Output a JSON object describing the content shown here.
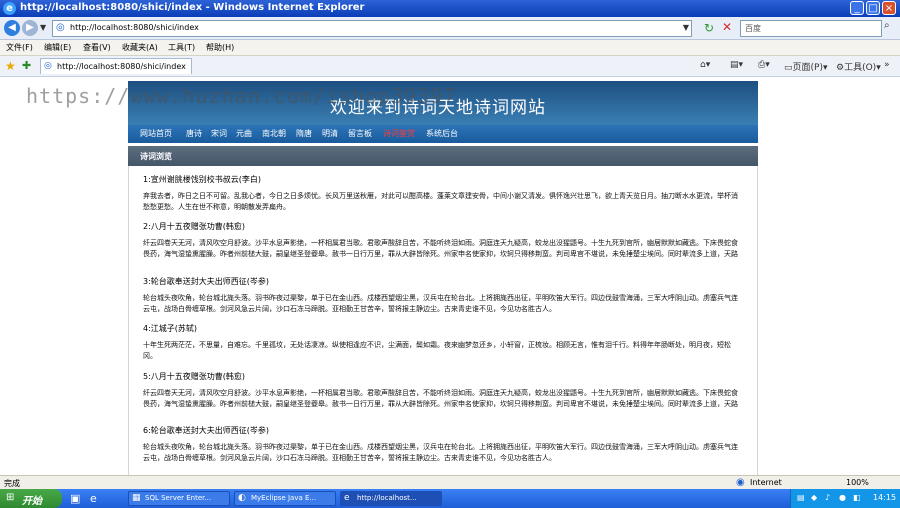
{
  "window": {
    "title": "http://localhost:8080/shici/index - Windows Internet Explorer",
    "min_glyph": "_",
    "max_glyph": "□",
    "close_glyph": "×"
  },
  "address": {
    "url": "http://localhost:8080/shici/index",
    "search_placeholder": "百度"
  },
  "menu": [
    "文件(F)",
    "编辑(E)",
    "查看(V)",
    "收藏夹(A)",
    "工具(T)",
    "帮助(H)"
  ],
  "tab": {
    "title": "http://localhost:8080/shici/index"
  },
  "toolbar": {
    "page": "页面(P)",
    "tools": "工具(O)",
    "more": "»"
  },
  "watermark": "https://www.huzhan.com/ishop39397",
  "site": {
    "banner_title": "欢迎来到诗词天地诗词网站",
    "nav": [
      "网站首页",
      "唐诗",
      "宋词",
      "元曲",
      "南北朝",
      "隋唐",
      "明清",
      "留言板",
      "诗词鉴赏",
      "系统后台"
    ],
    "active_nav": 8,
    "panel_title": "诗词浏览"
  },
  "poems": [
    {
      "title": "1:宣州谢朓楼饯别校书叔云(李白)",
      "body": "弃我去者，昨日之日不可留。乱我心者，今日之日多烦忧。长风万里送秋雁，对此可以酣高楼。蓬莱文章建安骨，中间小谢又清发。俱怀逸兴壮思飞，欲上青天览日月。抽刀断水水更流，举杯消愁愁更愁。人生在世不称意，明朝散发弄扁舟。"
    },
    {
      "title": "2:八月十五夜赠张功曹(韩愈)",
      "body": "纤云四卷天无河，清风吹空月舒波。沙平水息声影绝，一杯相属君当歌。君歌声酸辞且苦，不能听终泪如雨。洞庭连天九疑高，蛟龙出没猩鼯号。十生九死到官所，幽居默默如藏逃。下床畏蛇食畏药，海气湿蛰熏腥臊。昨者州前槌大鼓，嗣皇继圣登夔皋。赦书一日行万里，罪从大辟皆除死。州家申名使家抑，坎轲只得移荆蛮。判司卑官不堪说，未免捶楚尘埃间。同时辈流多上道，天路幽险难追攀。君歌且休听我歌，我歌今与君殊科：一年明月今宵多，人生由命非由他，有酒不饮奈明何？"
    },
    {
      "title": "3:轮台歌奉送封大夫出师西征(岑参)",
      "body": "轮台城头夜吹角，轮台城北旄头落。羽书昨夜过渠黎，单于已在金山西。戍楼西望烟尘黑，汉兵屯在轮台北。上将拥旄西出征，平明吹笛大军行。四边伐鼓雪海涌，三军大呼阴山动。虏塞兵气连云屯，战场白骨缠草根。剑河风急云片阔，沙口石冻马蹄脱。亚相勤王甘苦辛，誓将报主静边尘。古来青史谁不见，今见功名胜古人。"
    },
    {
      "title": "4:江城子(苏轼)",
      "body": "十年生死两茫茫，不思量，自难忘。千里孤坟，无处话凄凉。纵使相逢应不识，尘满面，鬓如霜。夜来幽梦忽还乡，小轩窗，正梳妆。相顾无言，惟有泪千行。料得年年肠断处，明月夜，短松冈。"
    },
    {
      "title": "5:八月十五夜赠张功曹(韩愈)",
      "body": "纤云四卷天无河，清风吹空月舒波。沙平水息声影绝，一杯相属君当歌。君歌声酸辞且苦，不能听终泪如雨。洞庭连天九疑高，蛟龙出没猩鼯号。十生九死到官所，幽居默默如藏逃。下床畏蛇食畏药，海气湿蛰熏腥臊。昨者州前槌大鼓，嗣皇继圣登夔皋。赦书一日行万里，罪从大辟皆除死。州家申名使家抑，坎轲只得移荆蛮。判司卑官不堪说，未免捶楚尘埃间。同时辈流多上道，天路幽险难追攀。君歌且休听我歌，我歌今与君殊科：一年明月今宵多，人生由命非由他，有酒不饮奈明何？"
    },
    {
      "title": "6:轮台歌奉送封大夫出师西征(岑参)",
      "body": "轮台城头夜吹角，轮台城北旄头落。羽书昨夜过渠黎，单于已在金山西。戍楼西望烟尘黑，汉兵屯在轮台北。上将拥旄西出征，平明吹笛大军行。四边伐鼓雪海涌，三军大呼阴山动。虏塞兵气连云屯，战场白骨缠草根。剑河风急云片阔，沙口石冻马蹄脱。亚相勤王甘苦辛，誓将报主静边尘。古来青史谁不见，今见功名胜古人。"
    }
  ],
  "status": {
    "left": "完成",
    "zone": "Internet",
    "zoom": "100%"
  },
  "taskbar": {
    "start": "开始",
    "items": [
      "SQL Server Enter...",
      "MyEclipse Java E...",
      "http://localhost..."
    ],
    "active_item": 2,
    "clock": "14:15"
  }
}
